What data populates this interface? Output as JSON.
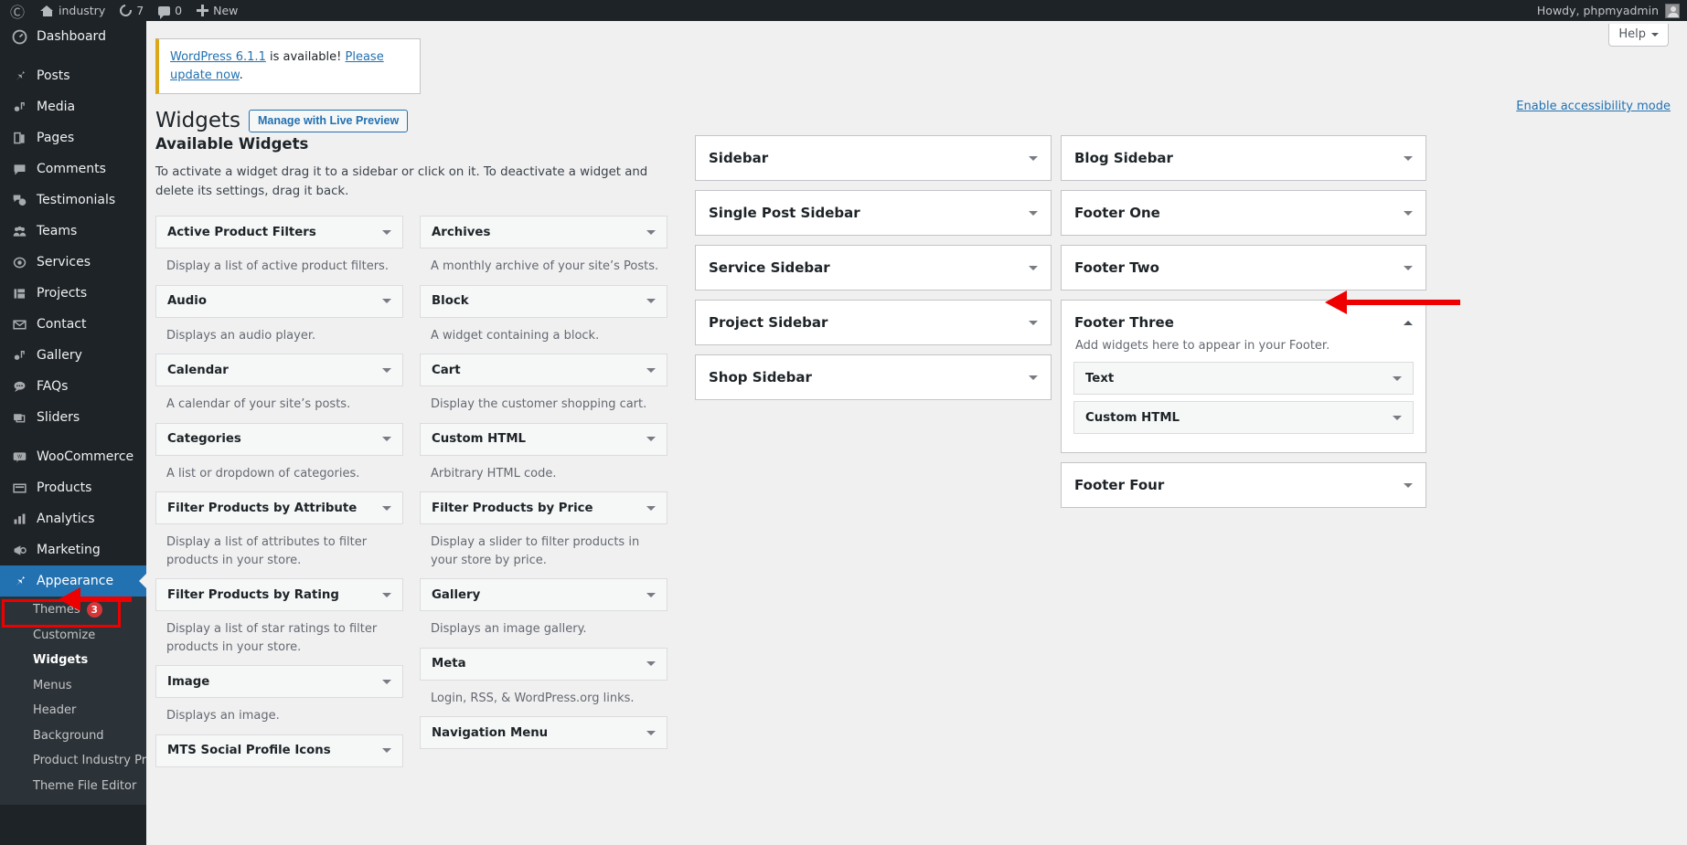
{
  "adminbar": {
    "logo_icon": "wordpress-logo-icon",
    "site_name": "industry",
    "updates_count": "7",
    "comments_count": "0",
    "new_label": "New",
    "howdy": "Howdy, phpmyadmin"
  },
  "help_button": {
    "label": "Help"
  },
  "update_nag": {
    "link_text": "WordPress 6.1.1",
    "middle_text": " is available! ",
    "update_link_text": "Please update now",
    "period": "."
  },
  "page": {
    "title": "Widgets",
    "live_preview_button": "Manage with Live Preview",
    "accessibility_link": "Enable accessibility mode"
  },
  "available": {
    "heading": "Available Widgets",
    "description": "To activate a widget drag it to a sidebar or click on it. To deactivate a widget and delete its settings, drag it back.",
    "left_column": [
      {
        "name": "Active Product Filters",
        "desc": "Display a list of active product filters."
      },
      {
        "name": "Audio",
        "desc": "Displays an audio player."
      },
      {
        "name": "Calendar",
        "desc": "A calendar of your site’s posts."
      },
      {
        "name": "Categories",
        "desc": "A list or dropdown of categories."
      },
      {
        "name": "Filter Products by Attribute",
        "desc": "Display a list of attributes to filter products in your store."
      },
      {
        "name": "Filter Products by Rating",
        "desc": "Display a list of star ratings to filter products in your store."
      },
      {
        "name": "Image",
        "desc": "Displays an image."
      },
      {
        "name": "MTS Social Profile Icons",
        "desc": ""
      }
    ],
    "right_column": [
      {
        "name": "Archives",
        "desc": "A monthly archive of your site’s Posts."
      },
      {
        "name": "Block",
        "desc": "A widget containing a block."
      },
      {
        "name": "Cart",
        "desc": "Display the customer shopping cart."
      },
      {
        "name": "Custom HTML",
        "desc": "Arbitrary HTML code."
      },
      {
        "name": "Filter Products by Price",
        "desc": "Display a slider to filter products in your store by price."
      },
      {
        "name": "Gallery",
        "desc": "Displays an image gallery."
      },
      {
        "name": "Meta",
        "desc": "Login, RSS, & WordPress.org links."
      },
      {
        "name": "Navigation Menu",
        "desc": ""
      }
    ]
  },
  "sidebars_middle": [
    {
      "name": "Sidebar"
    },
    {
      "name": "Single Post Sidebar"
    },
    {
      "name": "Service Sidebar"
    },
    {
      "name": "Project Sidebar"
    },
    {
      "name": "Shop Sidebar"
    }
  ],
  "sidebars_right": [
    {
      "name": "Blog Sidebar",
      "open": false
    },
    {
      "name": "Footer One",
      "open": false
    },
    {
      "name": "Footer Two",
      "open": false
    },
    {
      "name": "Footer Three",
      "open": true,
      "desc": "Add widgets here to appear in your Footer.",
      "widgets": [
        {
          "name": "Text"
        },
        {
          "name": "Custom HTML"
        }
      ]
    },
    {
      "name": "Footer Four",
      "open": false
    }
  ],
  "sidebar_menu": {
    "items": [
      {
        "label": "Dashboard",
        "icon": "dashboard-icon",
        "glyph": "◔"
      },
      {
        "sep": true
      },
      {
        "label": "Posts",
        "icon": "pin-icon",
        "glyph": "✒"
      },
      {
        "label": "Media",
        "icon": "media-icon",
        "glyph": "♫"
      },
      {
        "label": "Pages",
        "icon": "page-icon",
        "glyph": "◫"
      },
      {
        "label": "Comments",
        "icon": "comment-icon",
        "glyph": "■"
      },
      {
        "label": "Testimonials",
        "icon": "testimonials-icon",
        "glyph": "■"
      },
      {
        "label": "Teams",
        "icon": "teams-icon",
        "glyph": "⚪"
      },
      {
        "label": "Services",
        "icon": "services-icon",
        "glyph": "◉"
      },
      {
        "label": "Projects",
        "icon": "projects-icon",
        "glyph": "▤"
      },
      {
        "label": "Contact",
        "icon": "mail-icon",
        "glyph": "✉"
      },
      {
        "label": "Gallery",
        "icon": "gallery-icon",
        "glyph": "♫"
      },
      {
        "label": "FAQs",
        "icon": "faq-icon",
        "glyph": "●"
      },
      {
        "label": "Sliders",
        "icon": "sliders-icon",
        "glyph": "▧"
      },
      {
        "sep": true
      },
      {
        "label": "WooCommerce",
        "icon": "woocommerce-icon",
        "glyph": "W"
      },
      {
        "label": "Products",
        "icon": "products-icon",
        "glyph": "▭"
      },
      {
        "label": "Analytics",
        "icon": "analytics-icon",
        "glyph": "‖"
      },
      {
        "label": "Marketing",
        "icon": "megaphone-icon",
        "glyph": "◠"
      },
      {
        "label": "Appearance",
        "icon": "appearance-icon",
        "glyph": "✒",
        "current": true
      }
    ],
    "submenu": [
      {
        "label": "Themes",
        "badge": "3"
      },
      {
        "label": "Customize"
      },
      {
        "label": "Widgets",
        "current": true
      },
      {
        "label": "Menus"
      },
      {
        "label": "Header"
      },
      {
        "label": "Background"
      },
      {
        "label": "Product Industry Pro"
      },
      {
        "label": "Theme File Editor"
      }
    ]
  },
  "annotations": {
    "highlight_color": "#ee0000",
    "accent_blue": "#2271b1",
    "items": [
      {
        "name": "appearance-highlight-box"
      },
      {
        "name": "widgets-arrow"
      },
      {
        "name": "footer-three-arrow"
      }
    ]
  }
}
